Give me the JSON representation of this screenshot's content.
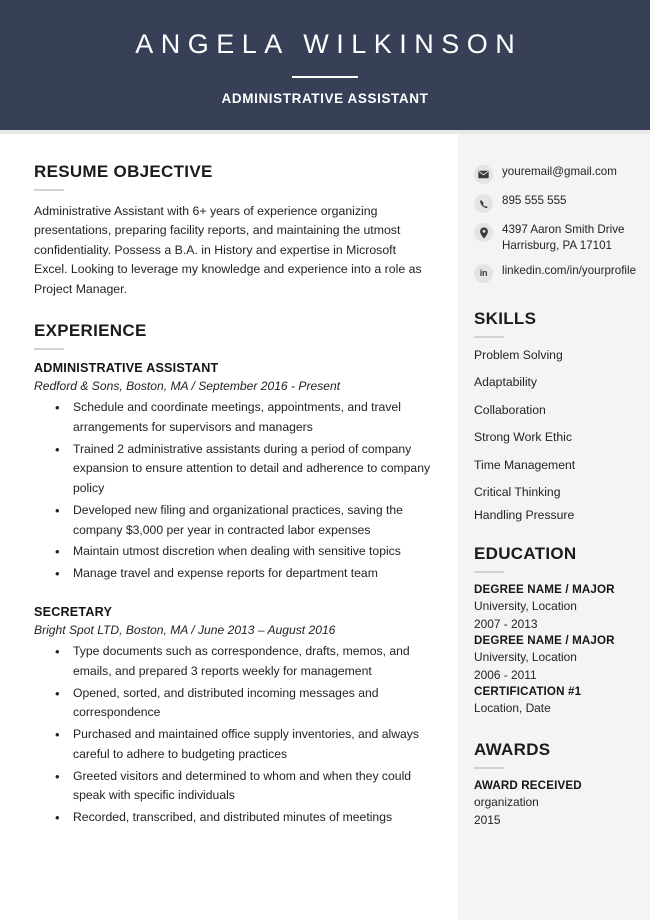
{
  "header": {
    "name": "ANGELA WILKINSON",
    "title": "ADMINISTRATIVE ASSISTANT"
  },
  "main": {
    "objective": {
      "heading": "RESUME OBJECTIVE",
      "text": "Administrative Assistant with 6+ years of experience organizing presentations, preparing facility reports, and maintaining the utmost confidentiality. Possess a B.A. in History and expertise in Microsoft Excel. Looking to leverage my knowledge and experience into a role as Project Manager."
    },
    "experience": {
      "heading": "EXPERIENCE",
      "jobs": [
        {
          "title": "ADMINISTRATIVE ASSISTANT",
          "meta": "Redford & Sons, Boston, MA  /  September 2016 - Present",
          "bullets": [
            "Schedule and coordinate meetings, appointments, and travel arrangements for supervisors and managers",
            "Trained 2 administrative assistants during a period of company expansion to ensure attention to detail and adherence to company policy",
            "Developed new filing and organizational practices, saving the company $3,000 per year in contracted labor expenses",
            "Maintain utmost discretion when dealing with sensitive topics",
            "Manage travel and expense reports for department team"
          ]
        },
        {
          "title": "SECRETARY",
          "meta": "Bright Spot LTD, Boston, MA  /  June 2013 – August 2016",
          "bullets": [
            "Type documents such as correspondence, drafts, memos, and emails, and prepared 3 reports weekly for management",
            "Opened, sorted, and distributed incoming messages and correspondence",
            "Purchased and maintained office supply inventories, and always careful to adhere to budgeting practices",
            "Greeted visitors and determined to whom and when they could speak with specific individuals",
            "Recorded, transcribed, and distributed minutes of meetings"
          ]
        }
      ]
    }
  },
  "sidebar": {
    "contacts": [
      {
        "icon": "envelope-icon",
        "text": "youremail@gmail.com"
      },
      {
        "icon": "phone-icon",
        "text": "895 555 555"
      },
      {
        "icon": "location-pin-icon",
        "line1": "4397 Aaron Smith Drive",
        "line2": "Harrisburg, PA 17101"
      },
      {
        "icon": "linkedin-icon",
        "text": "linkedin.com/in/yourprofile"
      }
    ],
    "skills": {
      "heading": "SKILLS",
      "items": [
        "Problem Solving",
        "Adaptability",
        "Collaboration",
        "Strong Work Ethic",
        "Time Management",
        "Critical Thinking",
        "Handling Pressure"
      ]
    },
    "education": {
      "heading": "EDUCATION",
      "entries": [
        {
          "title": "DEGREE NAME / MAJOR",
          "line1": "University, Location",
          "line2": "2007 - 2013"
        },
        {
          "title": "DEGREE NAME / MAJOR",
          "line1": "University, Location",
          "line2": "2006 - 2011"
        },
        {
          "title": "CERTIFICATION #1",
          "line1": "Location, Date",
          "line2": ""
        }
      ]
    },
    "awards": {
      "heading": "AWARDS",
      "entries": [
        {
          "title": "AWARD RECEIVED",
          "line1": "organization",
          "line2": "2015"
        }
      ]
    }
  },
  "colors": {
    "header_navy": "#374057",
    "sidebar_bg": "#f4f4f4",
    "rule_gray": "#d2d2d2",
    "icon_bg": "#e4e4e4"
  }
}
